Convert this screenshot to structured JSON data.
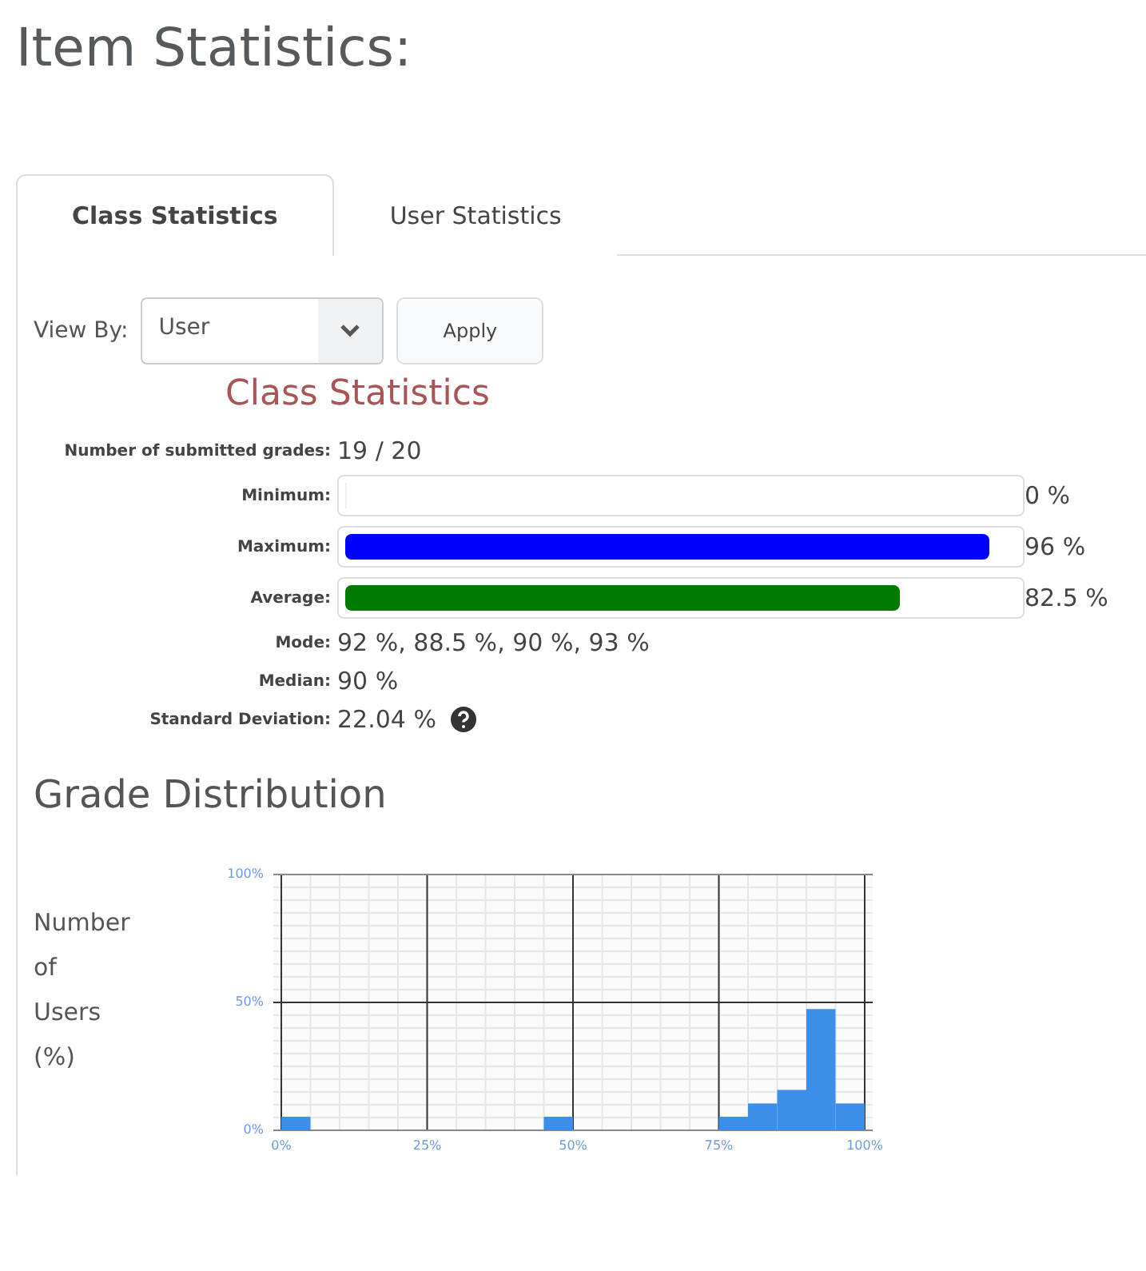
{
  "page_title": "Item Statistics:",
  "tabs": [
    {
      "label": "Class Statistics",
      "selected": true
    },
    {
      "label": "User Statistics",
      "selected": false
    }
  ],
  "view_by": {
    "label": "View By:",
    "value": "User",
    "button": "Apply"
  },
  "section_title": "Class Statistics",
  "submitted": {
    "label": "Number of submitted grades:",
    "value": "19 / 20"
  },
  "bars": [
    {
      "label": "Minimum:",
      "level": 0,
      "value": "0 %"
    },
    {
      "label": "Maximum:",
      "level": 0.96,
      "value": "96 %",
      "color": "#0000ff"
    },
    {
      "label": "Average:",
      "level": 0.825,
      "value": "82.5 %",
      "color": "#007a00"
    }
  ],
  "stats": [
    {
      "label": "Mode:",
      "value": "92 %, 88.5 %, 90 %, 93 %",
      "help": false
    },
    {
      "label": "Median:",
      "value": "90 %",
      "help": false
    },
    {
      "label": "Standard Deviation:",
      "value": "22.04 %",
      "help": true
    }
  ],
  "distribution": {
    "title": "Grade Distribution",
    "ylabel_lines": [
      "Number",
      "of",
      "Users",
      "(%)"
    ],
    "chart_data": {
      "type": "bar",
      "x": [
        2.5,
        7.5,
        12.5,
        17.5,
        22.5,
        27.5,
        32.5,
        37.5,
        42.5,
        47.5,
        52.5,
        57.5,
        62.5,
        67.5,
        72.5,
        77.5,
        82.5,
        87.5,
        92.5,
        97.5
      ],
      "xlim": [
        0,
        100
      ],
      "values": [
        5.3,
        0,
        0,
        0,
        0,
        0,
        0,
        0,
        0,
        5.3,
        0,
        0,
        0,
        0,
        0,
        5.3,
        10.5,
        15.8,
        47.4,
        10.5
      ],
      "grid": true,
      "ylim": [
        0,
        100
      ],
      "yticks": [
        {
          "value": 0,
          "label": "0%"
        },
        {
          "value": 50,
          "label": "50%"
        },
        {
          "value": 100,
          "label": "100%"
        }
      ],
      "xticks": [
        {
          "value": 0,
          "label": "0%"
        },
        {
          "value": 25,
          "label": "25%"
        },
        {
          "value": 50,
          "label": "50%"
        },
        {
          "value": 75,
          "label": "75%"
        },
        {
          "value": 100,
          "label": "100%"
        }
      ]
    }
  }
}
